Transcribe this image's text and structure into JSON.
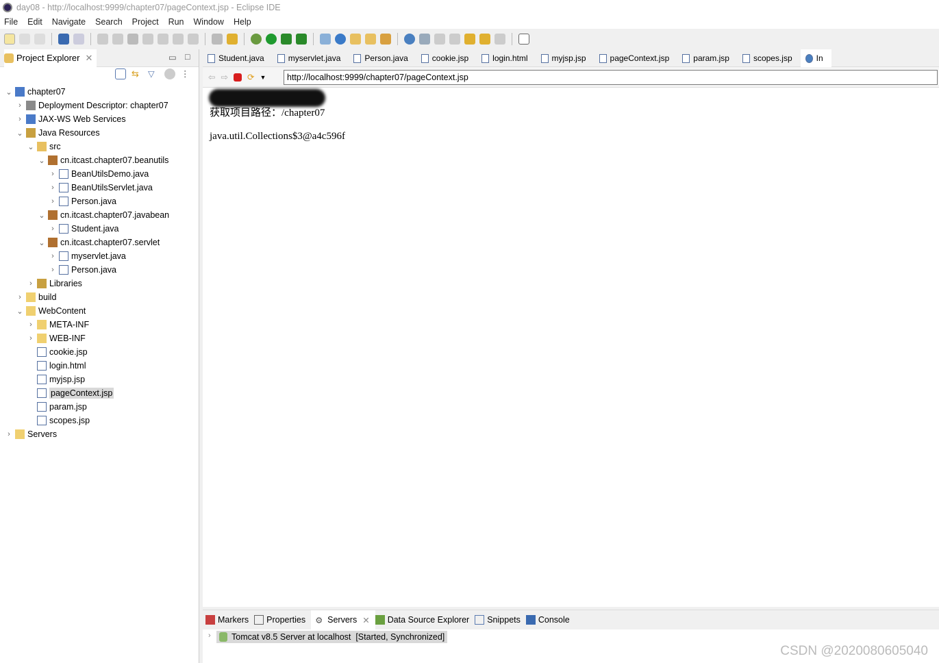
{
  "window": {
    "title": "day08 - http://localhost:9999/chapter07/pageContext.jsp - Eclipse IDE"
  },
  "menu": [
    "File",
    "Edit",
    "Navigate",
    "Search",
    "Project",
    "Run",
    "Window",
    "Help"
  ],
  "explorer": {
    "title": "Project Explorer",
    "tree": [
      {
        "label": "chapter07",
        "depth": 0,
        "arrow": "open",
        "icon": "project"
      },
      {
        "label": "Deployment Descriptor: chapter07",
        "depth": 1,
        "arrow": "closed",
        "icon": "descriptor"
      },
      {
        "label": "JAX-WS Web Services",
        "depth": 1,
        "arrow": "closed",
        "icon": "webservice"
      },
      {
        "label": "Java Resources",
        "depth": 1,
        "arrow": "open",
        "icon": "java-resources"
      },
      {
        "label": "src",
        "depth": 2,
        "arrow": "open",
        "icon": "source-folder"
      },
      {
        "label": "cn.itcast.chapter07.beanutils",
        "depth": 3,
        "arrow": "open",
        "icon": "package"
      },
      {
        "label": "BeanUtilsDemo.java",
        "depth": 4,
        "arrow": "closed",
        "icon": "java-file"
      },
      {
        "label": "BeanUtilsServlet.java",
        "depth": 4,
        "arrow": "closed",
        "icon": "java-file"
      },
      {
        "label": "Person.java",
        "depth": 4,
        "arrow": "closed",
        "icon": "java-file"
      },
      {
        "label": "cn.itcast.chapter07.javabean",
        "depth": 3,
        "arrow": "open",
        "icon": "package"
      },
      {
        "label": "Student.java",
        "depth": 4,
        "arrow": "closed",
        "icon": "java-file"
      },
      {
        "label": "cn.itcast.chapter07.servlet",
        "depth": 3,
        "arrow": "open",
        "icon": "package"
      },
      {
        "label": "myservlet.java",
        "depth": 4,
        "arrow": "closed",
        "icon": "java-file"
      },
      {
        "label": "Person.java",
        "depth": 4,
        "arrow": "closed",
        "icon": "java-file"
      },
      {
        "label": "Libraries",
        "depth": 2,
        "arrow": "closed",
        "icon": "library"
      },
      {
        "label": "build",
        "depth": 1,
        "arrow": "closed",
        "icon": "folder"
      },
      {
        "label": "WebContent",
        "depth": 1,
        "arrow": "open",
        "icon": "folder"
      },
      {
        "label": "META-INF",
        "depth": 2,
        "arrow": "closed",
        "icon": "folder"
      },
      {
        "label": "WEB-INF",
        "depth": 2,
        "arrow": "closed",
        "icon": "folder"
      },
      {
        "label": "cookie.jsp",
        "depth": 2,
        "arrow": "none",
        "icon": "file"
      },
      {
        "label": "login.html",
        "depth": 2,
        "arrow": "none",
        "icon": "file"
      },
      {
        "label": "myjsp.jsp",
        "depth": 2,
        "arrow": "none",
        "icon": "file"
      },
      {
        "label": "pageContext.jsp",
        "depth": 2,
        "arrow": "none",
        "icon": "file",
        "selected": true
      },
      {
        "label": "param.jsp",
        "depth": 2,
        "arrow": "none",
        "icon": "file"
      },
      {
        "label": "scopes.jsp",
        "depth": 2,
        "arrow": "none",
        "icon": "file"
      },
      {
        "label": "Servers",
        "depth": 0,
        "arrow": "closed",
        "icon": "folder"
      }
    ]
  },
  "editor_tabs": [
    {
      "label": "Student.java"
    },
    {
      "label": "myservlet.java"
    },
    {
      "label": "Person.java"
    },
    {
      "label": "cookie.jsp"
    },
    {
      "label": "login.html"
    },
    {
      "label": "myjsp.jsp"
    },
    {
      "label": "pageContext.jsp"
    },
    {
      "label": "param.jsp"
    },
    {
      "label": "scopes.jsp"
    },
    {
      "label": "In",
      "active": true
    }
  ],
  "browser": {
    "url": "http://localhost:9999/chapter07/pageContext.jsp",
    "line1_label": "获取项目路径：",
    "line1_value": "/chapter07",
    "line2": "java.util.Collections$3@a4c596f"
  },
  "bottom": {
    "tabs": [
      "Markers",
      "Properties",
      "Servers",
      "Data Source Explorer",
      "Snippets",
      "Console"
    ],
    "server": "Tomcat v8.5 Server at localhost  [Started, Synchronized]"
  },
  "watermark": "CSDN @2020080605040"
}
